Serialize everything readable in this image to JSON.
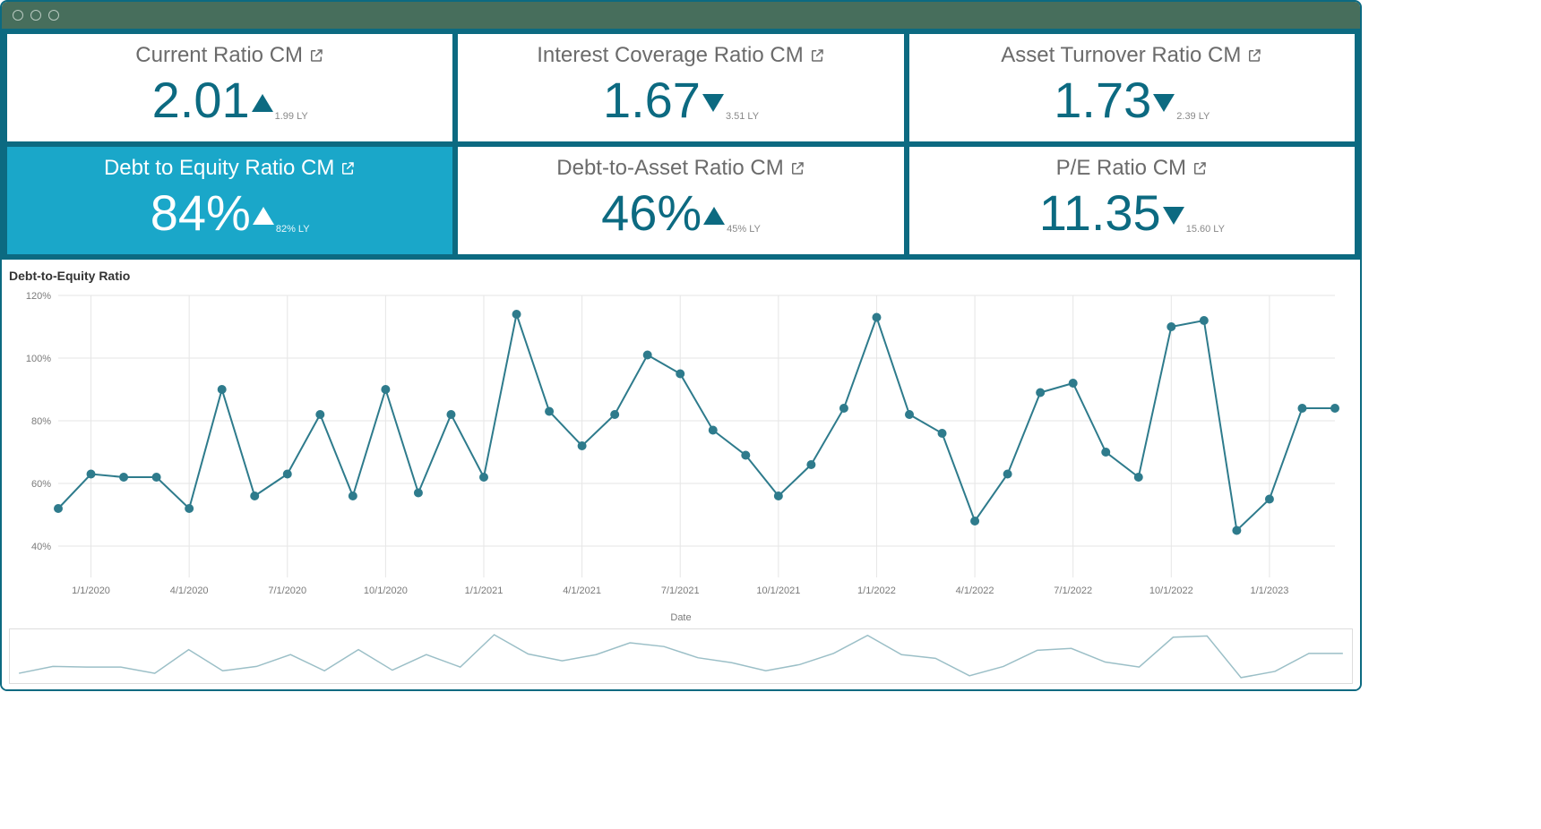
{
  "kpis": [
    {
      "id": "current-ratio",
      "title": "Current Ratio CM",
      "value": "2.01",
      "trend": "up",
      "ly": "1.99 LY",
      "selected": false
    },
    {
      "id": "interest-cov",
      "title": "Interest Coverage Ratio CM",
      "value": "1.67",
      "trend": "down",
      "ly": "3.51 LY",
      "selected": false
    },
    {
      "id": "asset-turnover",
      "title": "Asset Turnover Ratio CM",
      "value": "1.73",
      "trend": "down",
      "ly": "2.39 LY",
      "selected": false
    },
    {
      "id": "debt-equity",
      "title": "Debt to Equity Ratio CM",
      "value": "84%",
      "trend": "up",
      "ly": "82% LY",
      "selected": true
    },
    {
      "id": "debt-asset",
      "title": "Debt-to-Asset Ratio CM",
      "value": "46%",
      "trend": "up",
      "ly": "45% LY",
      "selected": false
    },
    {
      "id": "pe-ratio",
      "title": "P/E Ratio CM",
      "value": "11.35",
      "trend": "down",
      "ly": "15.60 LY",
      "selected": false
    }
  ],
  "chart": {
    "title": "Debt-to-Equity Ratio",
    "xlabel": "Date"
  },
  "chart_data": {
    "type": "line",
    "title": "Debt-to-Equity Ratio",
    "xlabel": "Date",
    "ylabel": "",
    "ylim": [
      30,
      120
    ],
    "y_ticks": [
      40,
      60,
      80,
      100,
      120
    ],
    "y_tick_labels": [
      "40%",
      "60%",
      "80%",
      "100%",
      "120%"
    ],
    "x_tick_labels": [
      "1/1/2020",
      "4/1/2020",
      "7/1/2020",
      "10/1/2020",
      "1/1/2021",
      "4/1/2021",
      "7/1/2021",
      "10/1/2021",
      "1/1/2022",
      "4/1/2022",
      "7/1/2022",
      "10/1/2022",
      "1/1/2023"
    ],
    "x": [
      "12/1/2019",
      "1/1/2020",
      "2/1/2020",
      "3/1/2020",
      "4/1/2020",
      "5/1/2020",
      "6/1/2020",
      "7/1/2020",
      "8/1/2020",
      "9/1/2020",
      "10/1/2020",
      "11/1/2020",
      "12/1/2020",
      "1/1/2021",
      "2/1/2021",
      "3/1/2021",
      "4/1/2021",
      "5/1/2021",
      "6/1/2021",
      "7/1/2021",
      "8/1/2021",
      "9/1/2021",
      "10/1/2021",
      "11/1/2021",
      "12/1/2021",
      "1/1/2022",
      "2/1/2022",
      "3/1/2022",
      "4/1/2022",
      "5/1/2022",
      "6/1/2022",
      "7/1/2022",
      "8/1/2022",
      "9/1/2022",
      "10/1/2022",
      "11/1/2022",
      "12/1/2022",
      "1/1/2023",
      "2/1/2023",
      "3/1/2023"
    ],
    "series": [
      {
        "name": "Debt-to-Equity Ratio",
        "values": [
          52,
          63,
          62,
          62,
          52,
          90,
          56,
          63,
          82,
          56,
          90,
          57,
          82,
          62,
          114,
          83,
          72,
          82,
          101,
          95,
          77,
          69,
          56,
          66,
          84,
          113,
          82,
          76,
          48,
          63,
          89,
          92,
          70,
          62,
          110,
          112,
          45,
          55,
          84,
          84
        ]
      }
    ]
  }
}
